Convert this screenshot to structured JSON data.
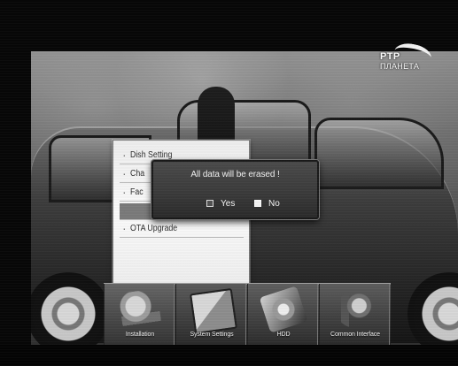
{
  "channel_logo": {
    "line_1": "РТР",
    "line_2": "ПЛАНЕТА"
  },
  "menu": {
    "items": [
      {
        "label": "Dish Setting"
      },
      {
        "label": "Cha"
      },
      {
        "label": "Fac"
      },
      {
        "label": ""
      },
      {
        "label": "OTA Upgrade"
      }
    ],
    "highlighted_index": 3
  },
  "dialog": {
    "message": "All data will be erased !",
    "options": [
      {
        "label": "Yes",
        "selected": false
      },
      {
        "label": "No",
        "selected": true
      }
    ]
  },
  "bottom_menu": {
    "items": [
      {
        "label": "Installation",
        "icon": "installation-icon"
      },
      {
        "label": "System Settings",
        "icon": "system-settings-icon"
      },
      {
        "label": "HDD",
        "icon": "hdd-icon"
      },
      {
        "label": "Common Interface",
        "icon": "common-interface-icon"
      }
    ]
  }
}
